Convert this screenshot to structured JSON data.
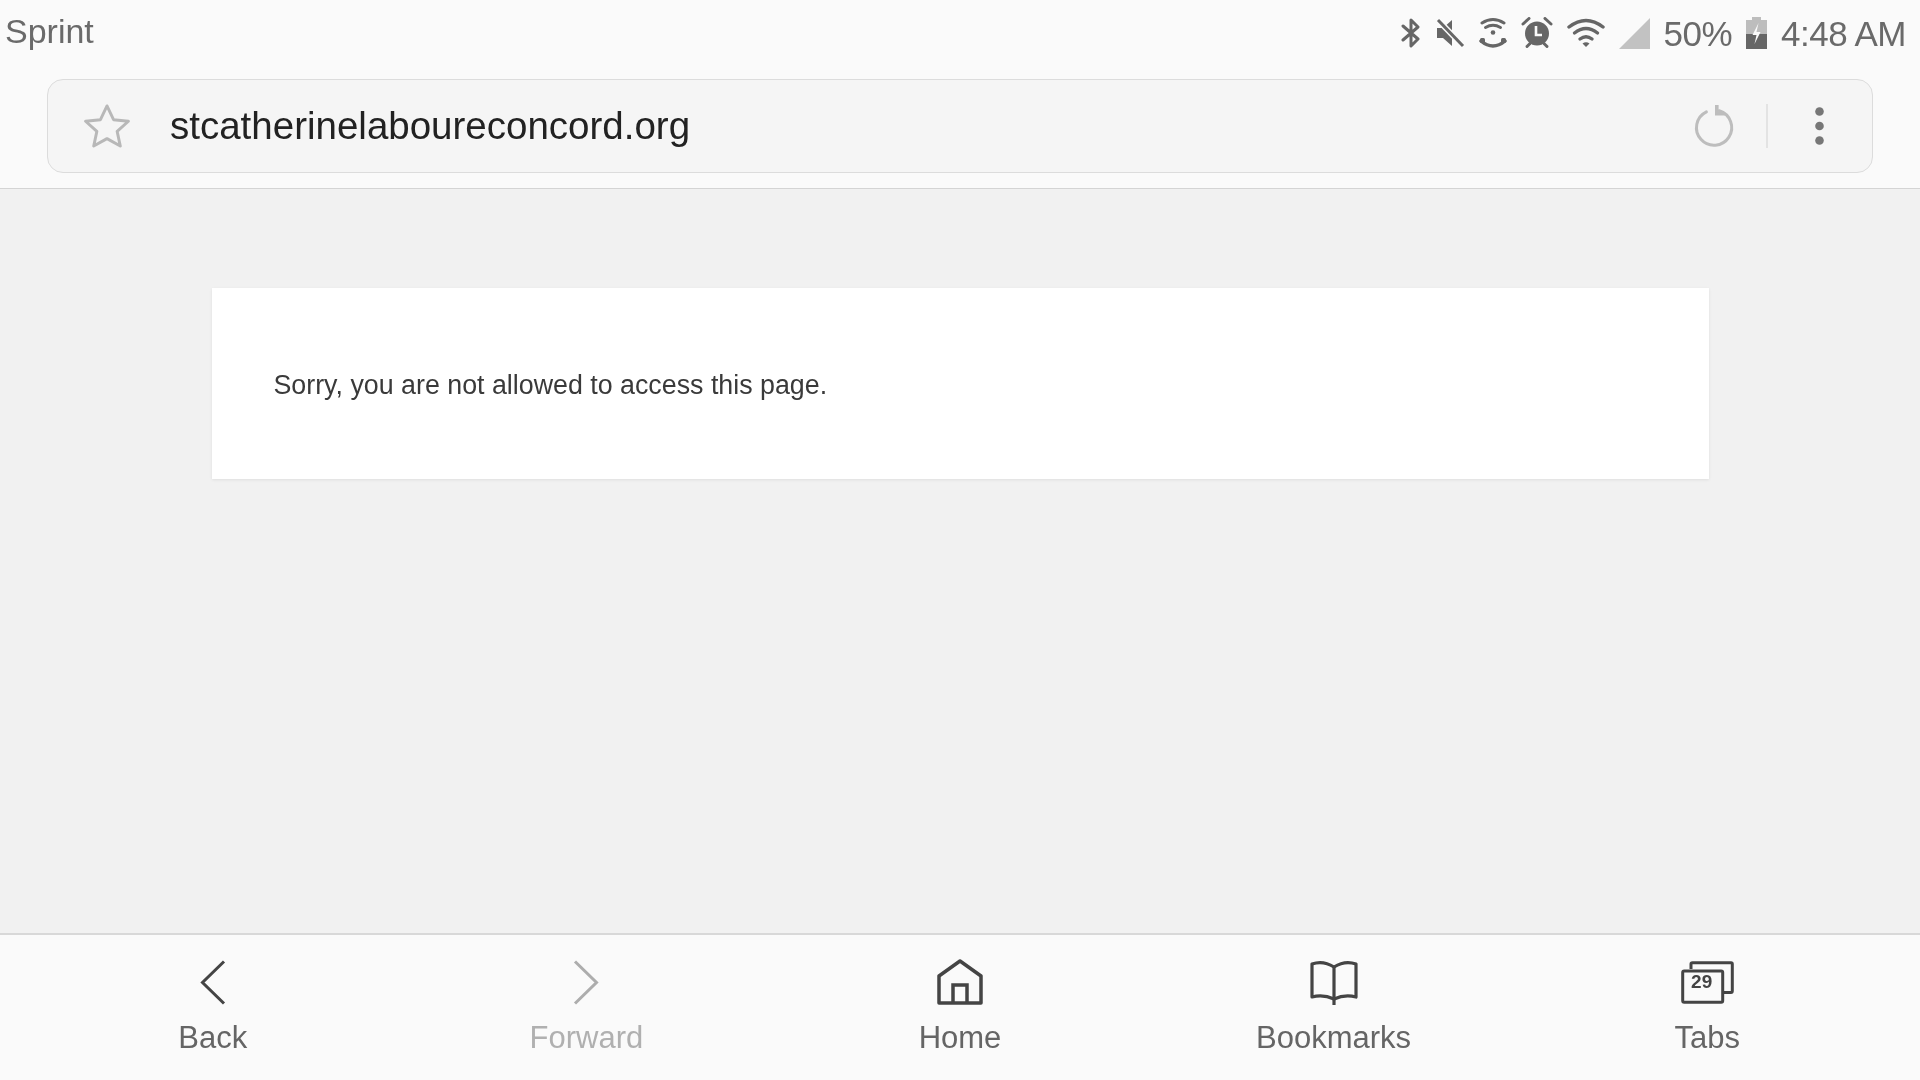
{
  "status_bar": {
    "carrier": "Sprint",
    "battery": "50%",
    "time": "4:48 AM"
  },
  "address_bar": {
    "url": "stcatherinelaboureconcord.org"
  },
  "page": {
    "message": "Sorry, you are not allowed to access this page."
  },
  "bottom_nav": [
    {
      "kind": "back",
      "label": "Back",
      "disabled": false
    },
    {
      "kind": "forward",
      "label": "Forward",
      "disabled": true
    },
    {
      "kind": "home",
      "label": "Home",
      "disabled": false
    },
    {
      "kind": "bookmarks",
      "label": "Bookmarks",
      "disabled": false
    },
    {
      "kind": "tabs",
      "label": "Tabs",
      "count": "29",
      "disabled": false
    }
  ]
}
